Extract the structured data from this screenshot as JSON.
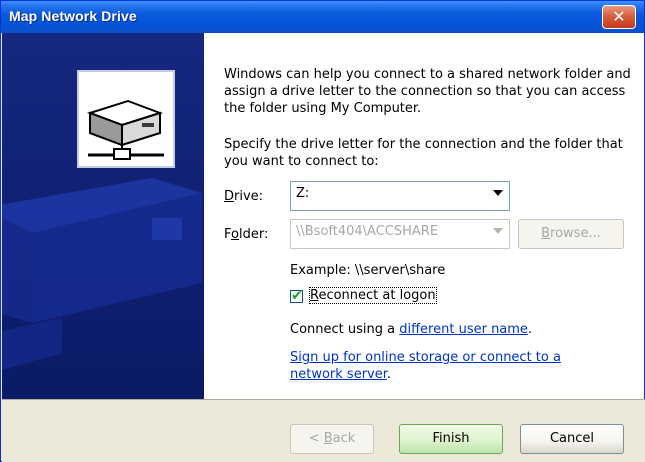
{
  "window": {
    "title": "Map Network Drive",
    "close_glyph": "✕"
  },
  "intro_text": "Windows can help you connect to a shared network folder and assign a drive letter to the connection so that you can access the folder using My Computer.",
  "spec_text": "Specify the drive letter for the connection and the folder that you want to connect to:",
  "drive": {
    "label_accel": "D",
    "label_rest": "rive:",
    "value": "Z:"
  },
  "folder": {
    "label_pre": "F",
    "label_accel": "o",
    "label_rest": "lder:",
    "value": "\\\\Bsoft404\\ACCSHARE",
    "browse_pre": "",
    "browse_accel": "B",
    "browse_rest": "rowse..."
  },
  "example_text": "Example: \\\\server\\share",
  "reconnect": {
    "checked": true,
    "check_glyph": "✔",
    "label_accel": "R",
    "label_rest": "econnect at logon"
  },
  "connect_using": {
    "prefix": "Connect using a ",
    "link": "different user name",
    "suffix": "."
  },
  "signup": {
    "line1": "Sign up for online storage or connect to a",
    "line2": "network server",
    "suffix": "."
  },
  "buttons": {
    "back_pre": "< ",
    "back_accel": "B",
    "back_rest": "ack",
    "finish": "Finish",
    "cancel": "Cancel"
  },
  "icons": {
    "banner": "network-drive-icon"
  }
}
